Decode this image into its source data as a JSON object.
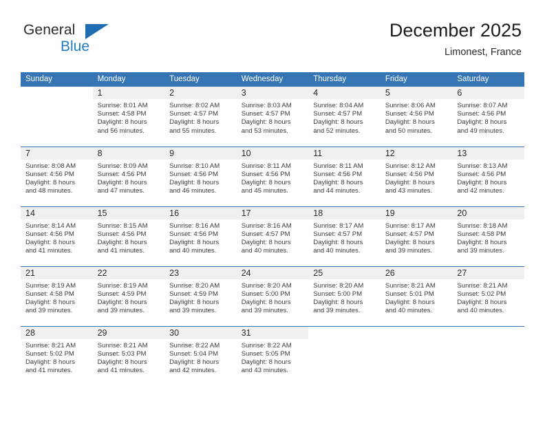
{
  "brand": {
    "name_part1": "General",
    "name_part2": "Blue",
    "colors": {
      "dark": "#2b2b2b",
      "blue": "#1f7ac0",
      "triangle": "#1f6cb0"
    }
  },
  "header": {
    "title": "December 2025",
    "subtitle": "Limonest, France"
  },
  "colors": {
    "header_row_bg": "#3575b4",
    "day_number_bg": "#f0f0f0",
    "week_divider": "#3575b4",
    "cell_bg": "#ffffff"
  },
  "day_headers": [
    "Sunday",
    "Monday",
    "Tuesday",
    "Wednesday",
    "Thursday",
    "Friday",
    "Saturday"
  ],
  "weeks": [
    [
      {
        "blank": true
      },
      {
        "day": "1",
        "sunrise": "Sunrise: 8:01 AM",
        "sunset": "Sunset: 4:58 PM",
        "daylight_line1": "Daylight: 8 hours",
        "daylight_line2": "and 56 minutes."
      },
      {
        "day": "2",
        "sunrise": "Sunrise: 8:02 AM",
        "sunset": "Sunset: 4:57 PM",
        "daylight_line1": "Daylight: 8 hours",
        "daylight_line2": "and 55 minutes."
      },
      {
        "day": "3",
        "sunrise": "Sunrise: 8:03 AM",
        "sunset": "Sunset: 4:57 PM",
        "daylight_line1": "Daylight: 8 hours",
        "daylight_line2": "and 53 minutes."
      },
      {
        "day": "4",
        "sunrise": "Sunrise: 8:04 AM",
        "sunset": "Sunset: 4:57 PM",
        "daylight_line1": "Daylight: 8 hours",
        "daylight_line2": "and 52 minutes."
      },
      {
        "day": "5",
        "sunrise": "Sunrise: 8:06 AM",
        "sunset": "Sunset: 4:56 PM",
        "daylight_line1": "Daylight: 8 hours",
        "daylight_line2": "and 50 minutes."
      },
      {
        "day": "6",
        "sunrise": "Sunrise: 8:07 AM",
        "sunset": "Sunset: 4:56 PM",
        "daylight_line1": "Daylight: 8 hours",
        "daylight_line2": "and 49 minutes."
      }
    ],
    [
      {
        "day": "7",
        "sunrise": "Sunrise: 8:08 AM",
        "sunset": "Sunset: 4:56 PM",
        "daylight_line1": "Daylight: 8 hours",
        "daylight_line2": "and 48 minutes."
      },
      {
        "day": "8",
        "sunrise": "Sunrise: 8:09 AM",
        "sunset": "Sunset: 4:56 PM",
        "daylight_line1": "Daylight: 8 hours",
        "daylight_line2": "and 47 minutes."
      },
      {
        "day": "9",
        "sunrise": "Sunrise: 8:10 AM",
        "sunset": "Sunset: 4:56 PM",
        "daylight_line1": "Daylight: 8 hours",
        "daylight_line2": "and 46 minutes."
      },
      {
        "day": "10",
        "sunrise": "Sunrise: 8:11 AM",
        "sunset": "Sunset: 4:56 PM",
        "daylight_line1": "Daylight: 8 hours",
        "daylight_line2": "and 45 minutes."
      },
      {
        "day": "11",
        "sunrise": "Sunrise: 8:11 AM",
        "sunset": "Sunset: 4:56 PM",
        "daylight_line1": "Daylight: 8 hours",
        "daylight_line2": "and 44 minutes."
      },
      {
        "day": "12",
        "sunrise": "Sunrise: 8:12 AM",
        "sunset": "Sunset: 4:56 PM",
        "daylight_line1": "Daylight: 8 hours",
        "daylight_line2": "and 43 minutes."
      },
      {
        "day": "13",
        "sunrise": "Sunrise: 8:13 AM",
        "sunset": "Sunset: 4:56 PM",
        "daylight_line1": "Daylight: 8 hours",
        "daylight_line2": "and 42 minutes."
      }
    ],
    [
      {
        "day": "14",
        "sunrise": "Sunrise: 8:14 AM",
        "sunset": "Sunset: 4:56 PM",
        "daylight_line1": "Daylight: 8 hours",
        "daylight_line2": "and 41 minutes."
      },
      {
        "day": "15",
        "sunrise": "Sunrise: 8:15 AM",
        "sunset": "Sunset: 4:56 PM",
        "daylight_line1": "Daylight: 8 hours",
        "daylight_line2": "and 41 minutes."
      },
      {
        "day": "16",
        "sunrise": "Sunrise: 8:16 AM",
        "sunset": "Sunset: 4:56 PM",
        "daylight_line1": "Daylight: 8 hours",
        "daylight_line2": "and 40 minutes."
      },
      {
        "day": "17",
        "sunrise": "Sunrise: 8:16 AM",
        "sunset": "Sunset: 4:57 PM",
        "daylight_line1": "Daylight: 8 hours",
        "daylight_line2": "and 40 minutes."
      },
      {
        "day": "18",
        "sunrise": "Sunrise: 8:17 AM",
        "sunset": "Sunset: 4:57 PM",
        "daylight_line1": "Daylight: 8 hours",
        "daylight_line2": "and 40 minutes."
      },
      {
        "day": "19",
        "sunrise": "Sunrise: 8:17 AM",
        "sunset": "Sunset: 4:57 PM",
        "daylight_line1": "Daylight: 8 hours",
        "daylight_line2": "and 39 minutes."
      },
      {
        "day": "20",
        "sunrise": "Sunrise: 8:18 AM",
        "sunset": "Sunset: 4:58 PM",
        "daylight_line1": "Daylight: 8 hours",
        "daylight_line2": "and 39 minutes."
      }
    ],
    [
      {
        "day": "21",
        "sunrise": "Sunrise: 8:19 AM",
        "sunset": "Sunset: 4:58 PM",
        "daylight_line1": "Daylight: 8 hours",
        "daylight_line2": "and 39 minutes."
      },
      {
        "day": "22",
        "sunrise": "Sunrise: 8:19 AM",
        "sunset": "Sunset: 4:59 PM",
        "daylight_line1": "Daylight: 8 hours",
        "daylight_line2": "and 39 minutes."
      },
      {
        "day": "23",
        "sunrise": "Sunrise: 8:20 AM",
        "sunset": "Sunset: 4:59 PM",
        "daylight_line1": "Daylight: 8 hours",
        "daylight_line2": "and 39 minutes."
      },
      {
        "day": "24",
        "sunrise": "Sunrise: 8:20 AM",
        "sunset": "Sunset: 5:00 PM",
        "daylight_line1": "Daylight: 8 hours",
        "daylight_line2": "and 39 minutes."
      },
      {
        "day": "25",
        "sunrise": "Sunrise: 8:20 AM",
        "sunset": "Sunset: 5:00 PM",
        "daylight_line1": "Daylight: 8 hours",
        "daylight_line2": "and 39 minutes."
      },
      {
        "day": "26",
        "sunrise": "Sunrise: 8:21 AM",
        "sunset": "Sunset: 5:01 PM",
        "daylight_line1": "Daylight: 8 hours",
        "daylight_line2": "and 40 minutes."
      },
      {
        "day": "27",
        "sunrise": "Sunrise: 8:21 AM",
        "sunset": "Sunset: 5:02 PM",
        "daylight_line1": "Daylight: 8 hours",
        "daylight_line2": "and 40 minutes."
      }
    ],
    [
      {
        "day": "28",
        "sunrise": "Sunrise: 8:21 AM",
        "sunset": "Sunset: 5:02 PM",
        "daylight_line1": "Daylight: 8 hours",
        "daylight_line2": "and 41 minutes."
      },
      {
        "day": "29",
        "sunrise": "Sunrise: 8:21 AM",
        "sunset": "Sunset: 5:03 PM",
        "daylight_line1": "Daylight: 8 hours",
        "daylight_line2": "and 41 minutes."
      },
      {
        "day": "30",
        "sunrise": "Sunrise: 8:22 AM",
        "sunset": "Sunset: 5:04 PM",
        "daylight_line1": "Daylight: 8 hours",
        "daylight_line2": "and 42 minutes."
      },
      {
        "day": "31",
        "sunrise": "Sunrise: 8:22 AM",
        "sunset": "Sunset: 5:05 PM",
        "daylight_line1": "Daylight: 8 hours",
        "daylight_line2": "and 43 minutes."
      },
      {
        "blank": true
      },
      {
        "blank": true
      },
      {
        "blank": true
      }
    ]
  ]
}
